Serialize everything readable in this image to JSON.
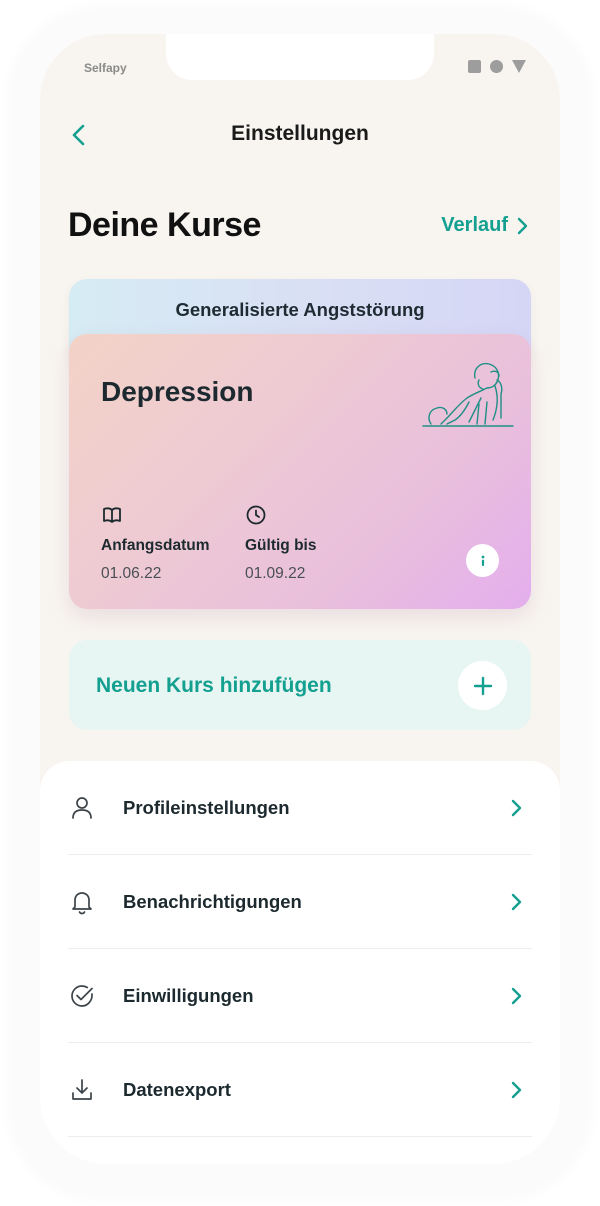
{
  "status_bar": {
    "carrier": "Selfapy"
  },
  "nav": {
    "title": "Einstellungen",
    "back_icon": "chevron-left-icon"
  },
  "courses": {
    "heading": "Deine Kurse",
    "history_label": "Verlauf",
    "stacked_course": "Generalisierte Angststörung",
    "active_course": {
      "name": "Depression",
      "start_label": "Anfangsdatum",
      "start_value": "01.06.22",
      "valid_label": "Gültig bis",
      "valid_value": "01.09.22"
    },
    "add_label": "Neuen Kurs hinzufügen"
  },
  "settings": {
    "items": [
      {
        "label": "Profileinstellungen",
        "icon": "person-icon"
      },
      {
        "label": "Benachrichtigungen",
        "icon": "bell-icon"
      },
      {
        "label": "Einwilligungen",
        "icon": "check-circle-icon"
      },
      {
        "label": "Datenexport",
        "icon": "download-icon"
      }
    ]
  },
  "colors": {
    "accent": "#14a090",
    "background": "#f8f5f0",
    "add_card": "#e7f6f2",
    "text_dark": "#1c2a2f"
  }
}
